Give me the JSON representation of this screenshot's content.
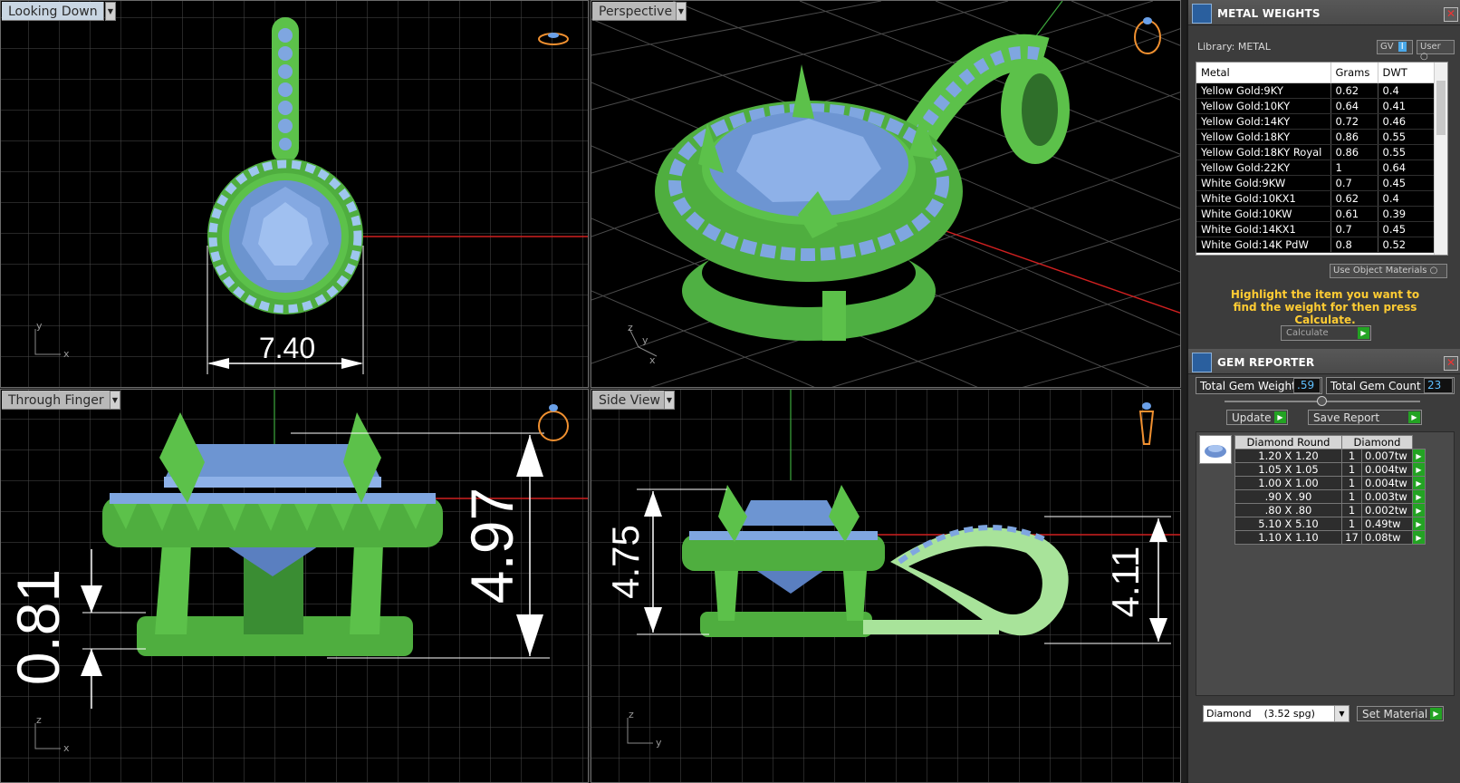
{
  "viewports": [
    {
      "label": "Looking Down",
      "dimension": "7.40",
      "axes": [
        "y",
        "x"
      ]
    },
    {
      "label": "Perspective",
      "axes": [
        "z",
        "y",
        "x"
      ]
    },
    {
      "label": "Through Finger",
      "dimensions": [
        "4.97",
        "0.81"
      ],
      "axes": [
        "z",
        "x"
      ]
    },
    {
      "label": "Side View",
      "dimensions": [
        "4.75",
        "4.11"
      ],
      "axes": [
        "z",
        "y"
      ]
    }
  ],
  "metal_weights": {
    "title": "METAL WEIGHTS",
    "library_label": "Library: METAL",
    "gv_label": "GV",
    "gv_badge": "I",
    "user_label": "User",
    "columns": [
      "Metal",
      "Grams",
      "DWT"
    ],
    "rows": [
      [
        "Yellow Gold:9KY",
        "0.62",
        "0.4"
      ],
      [
        "Yellow Gold:10KY",
        "0.64",
        "0.41"
      ],
      [
        "Yellow Gold:14KY",
        "0.72",
        "0.46"
      ],
      [
        "Yellow Gold:18KY",
        "0.86",
        "0.55"
      ],
      [
        "Yellow Gold:18KY Royal",
        "0.86",
        "0.55"
      ],
      [
        "Yellow Gold:22KY",
        "1",
        "0.64"
      ],
      [
        "White Gold:9KW",
        "0.7",
        "0.45"
      ],
      [
        "White Gold:10KX1",
        "0.62",
        "0.4"
      ],
      [
        "White Gold:10KW",
        "0.61",
        "0.39"
      ],
      [
        "White Gold:14KX1",
        "0.7",
        "0.45"
      ],
      [
        "White Gold:14K PdW",
        "0.8",
        "0.52"
      ]
    ],
    "use_object_materials": "Use Object Materials",
    "hint": "Highlight the item you want to find the weight for then press Calculate.",
    "calculate_label": "Calculate"
  },
  "gem_reporter": {
    "title": "GEM REPORTER",
    "total_weight_label": "Total Gem Weight",
    "total_weight_value": ".59",
    "total_count_label": "Total Gem Count",
    "total_count_value": "23",
    "update_label": "Update",
    "save_report_label": "Save Report",
    "columns": [
      "Diamond Round",
      "Diamond"
    ],
    "rows": [
      [
        "1.20 X 1.20",
        "1",
        "0.007tw"
      ],
      [
        "1.05 X 1.05",
        "1",
        "0.004tw"
      ],
      [
        "1.00 X 1.00",
        "1",
        "0.004tw"
      ],
      [
        ".90 X .90",
        "1",
        "0.003tw"
      ],
      [
        ".80 X .80",
        "1",
        "0.002tw"
      ],
      [
        "5.10 X 5.10",
        "1",
        "0.49tw"
      ],
      [
        "1.10 X 1.10",
        "17",
        "0.08tw"
      ]
    ],
    "material_select": "Diamond    (3.52 spg)",
    "set_material_label": "Set Material"
  }
}
